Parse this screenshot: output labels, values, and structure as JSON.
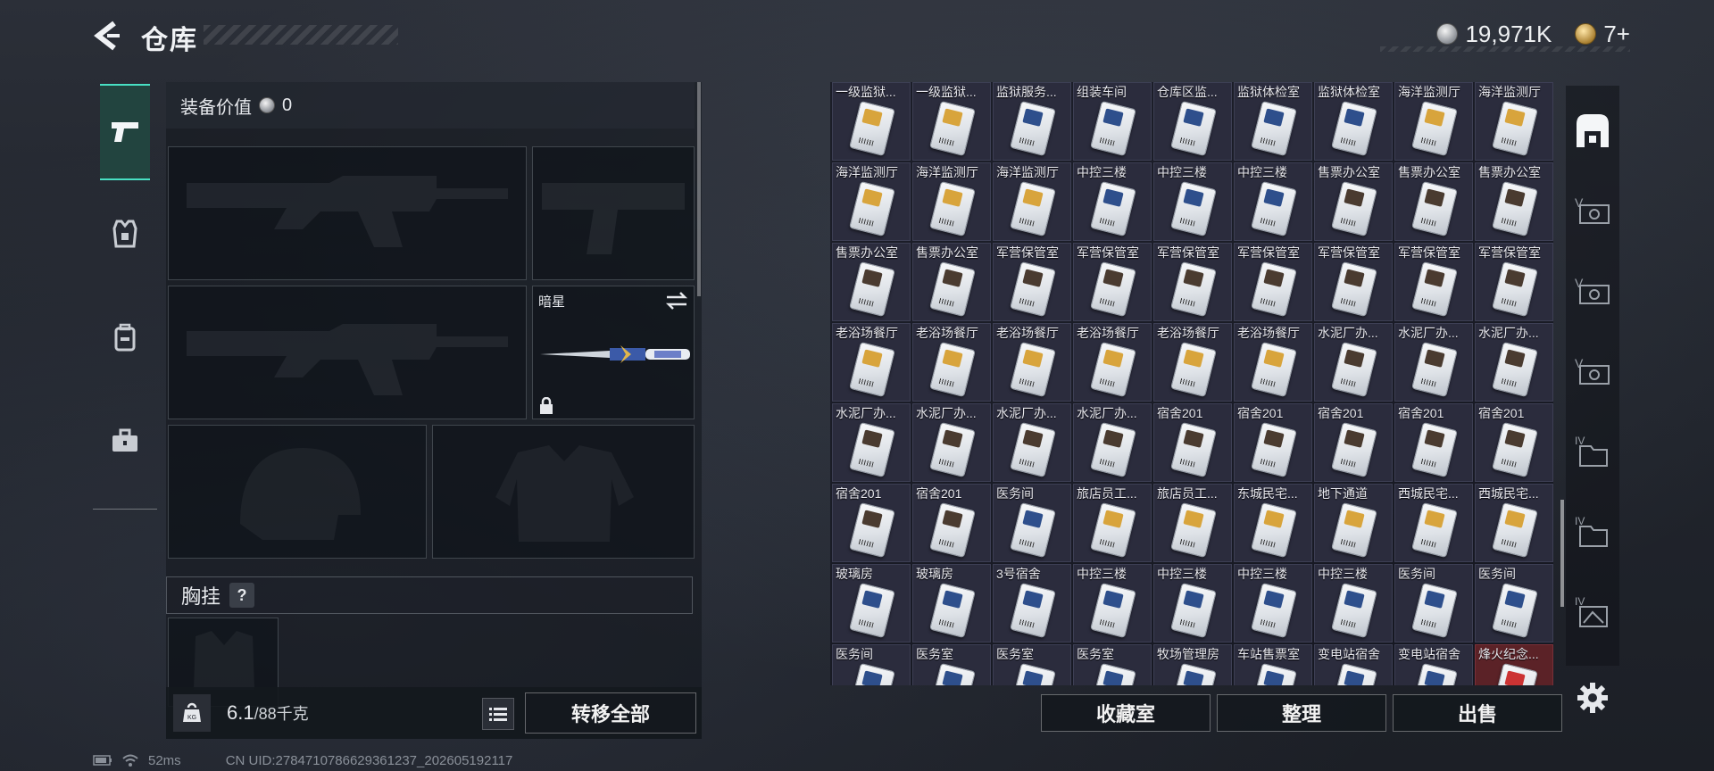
{
  "header": {
    "title": "仓库",
    "currency": [
      {
        "icon": "silver-coin-icon",
        "value": "19,971K"
      },
      {
        "icon": "gold-gem-icon",
        "value": "7+"
      }
    ]
  },
  "left_tabs": [
    {
      "icon": "pistol-icon",
      "active": true
    },
    {
      "icon": "armor-vest-icon",
      "active": false
    },
    {
      "icon": "backpack-icon",
      "active": false
    },
    {
      "icon": "toolbox-icon",
      "active": false
    }
  ],
  "loadout": {
    "equip_value_label": "装备价值",
    "equip_value": "0",
    "melee_name": "暗星",
    "chest_label": "胸挂",
    "chest_help": "?",
    "weight_value": "6.1",
    "weight_max": "/88千克",
    "transfer_all": "转移全部"
  },
  "status": {
    "ping": "52ms",
    "uid": "CN UID:2784710786629361237_202605192117"
  },
  "inventory": {
    "items": [
      {
        "label": "一级监狱...",
        "card": "gold"
      },
      {
        "label": "一级监狱...",
        "card": "gold"
      },
      {
        "label": "监狱服务...",
        "card": "blue"
      },
      {
        "label": "组装车间",
        "card": "blue"
      },
      {
        "label": "仓库区监...",
        "card": "blue"
      },
      {
        "label": "监狱体检室",
        "card": "blue"
      },
      {
        "label": "监狱体检室",
        "card": "blue"
      },
      {
        "label": "海洋监测厅",
        "card": "gold"
      },
      {
        "label": "海洋监测厅",
        "card": "gold"
      },
      {
        "label": "海洋监测厅",
        "card": "gold"
      },
      {
        "label": "海洋监测厅",
        "card": "gold"
      },
      {
        "label": "海洋监测厅",
        "card": "gold"
      },
      {
        "label": "中控三楼",
        "card": "blue"
      },
      {
        "label": "中控三楼",
        "card": "blue"
      },
      {
        "label": "中控三楼",
        "card": "blue"
      },
      {
        "label": "售票办公室",
        "card": "brown"
      },
      {
        "label": "售票办公室",
        "card": "brown"
      },
      {
        "label": "售票办公室",
        "card": "brown"
      },
      {
        "label": "售票办公室",
        "card": "brown"
      },
      {
        "label": "售票办公室",
        "card": "brown"
      },
      {
        "label": "军营保管室",
        "card": "brown"
      },
      {
        "label": "军营保管室",
        "card": "brown"
      },
      {
        "label": "军营保管室",
        "card": "brown"
      },
      {
        "label": "军营保管室",
        "card": "brown"
      },
      {
        "label": "军营保管室",
        "card": "brown"
      },
      {
        "label": "军营保管室",
        "card": "brown"
      },
      {
        "label": "军营保管室",
        "card": "brown"
      },
      {
        "label": "老浴场餐厅",
        "card": "gold"
      },
      {
        "label": "老浴场餐厅",
        "card": "gold"
      },
      {
        "label": "老浴场餐厅",
        "card": "gold"
      },
      {
        "label": "老浴场餐厅",
        "card": "gold"
      },
      {
        "label": "老浴场餐厅",
        "card": "gold"
      },
      {
        "label": "老浴场餐厅",
        "card": "gold"
      },
      {
        "label": "水泥厂办...",
        "card": "brown"
      },
      {
        "label": "水泥厂办...",
        "card": "brown"
      },
      {
        "label": "水泥厂办...",
        "card": "brown"
      },
      {
        "label": "水泥厂办...",
        "card": "brown"
      },
      {
        "label": "水泥厂办...",
        "card": "brown"
      },
      {
        "label": "水泥厂办...",
        "card": "brown"
      },
      {
        "label": "水泥厂办...",
        "card": "brown"
      },
      {
        "label": "宿舍201",
        "card": "brown"
      },
      {
        "label": "宿舍201",
        "card": "brown"
      },
      {
        "label": "宿舍201",
        "card": "brown"
      },
      {
        "label": "宿舍201",
        "card": "brown"
      },
      {
        "label": "宿舍201",
        "card": "brown"
      },
      {
        "label": "宿舍201",
        "card": "brown"
      },
      {
        "label": "宿舍201",
        "card": "brown"
      },
      {
        "label": "医务间",
        "card": "blue"
      },
      {
        "label": "旅店员工...",
        "card": "gold"
      },
      {
        "label": "旅店员工...",
        "card": "gold"
      },
      {
        "label": "东城民宅...",
        "card": "gold"
      },
      {
        "label": "地下通道",
        "card": "gold"
      },
      {
        "label": "西城民宅...",
        "card": "gold"
      },
      {
        "label": "西城民宅...",
        "card": "gold"
      },
      {
        "label": "玻璃房",
        "card": "blue"
      },
      {
        "label": "玻璃房",
        "card": "blue"
      },
      {
        "label": "3号宿舍",
        "card": "blue"
      },
      {
        "label": "中控三楼",
        "card": "blue"
      },
      {
        "label": "中控三楼",
        "card": "blue"
      },
      {
        "label": "中控三楼",
        "card": "blue"
      },
      {
        "label": "中控三楼",
        "card": "blue"
      },
      {
        "label": "医务间",
        "card": "blue"
      },
      {
        "label": "医务间",
        "card": "blue"
      },
      {
        "label": "医务间",
        "card": "blue"
      },
      {
        "label": "医务室",
        "card": "blue"
      },
      {
        "label": "医务室",
        "card": "blue"
      },
      {
        "label": "医务室",
        "card": "blue"
      },
      {
        "label": "牧场管理房",
        "card": "blue"
      },
      {
        "label": "车站售票室",
        "card": "blue"
      },
      {
        "label": "变电站宿舍",
        "card": "blue"
      },
      {
        "label": "变电站宿舍",
        "card": "blue"
      },
      {
        "label": "烽火纪念...",
        "card": "red"
      }
    ],
    "collection_room": "收藏室",
    "organize": "整理",
    "sell": "出售"
  },
  "right_tabs": [
    {
      "icon": "safe-box-icon",
      "active": true
    },
    {
      "icon": "vehicle-card-v-icon"
    },
    {
      "icon": "vehicle-card-v-icon"
    },
    {
      "icon": "vehicle-card-v-icon"
    },
    {
      "icon": "folder-iv-icon"
    },
    {
      "icon": "folder-iv-icon"
    },
    {
      "icon": "frame-iv-icon"
    }
  ],
  "colors": {
    "accent": "#48e0c3",
    "cell_bg": "#2b2c3d",
    "cell_red": "#5b2227"
  }
}
